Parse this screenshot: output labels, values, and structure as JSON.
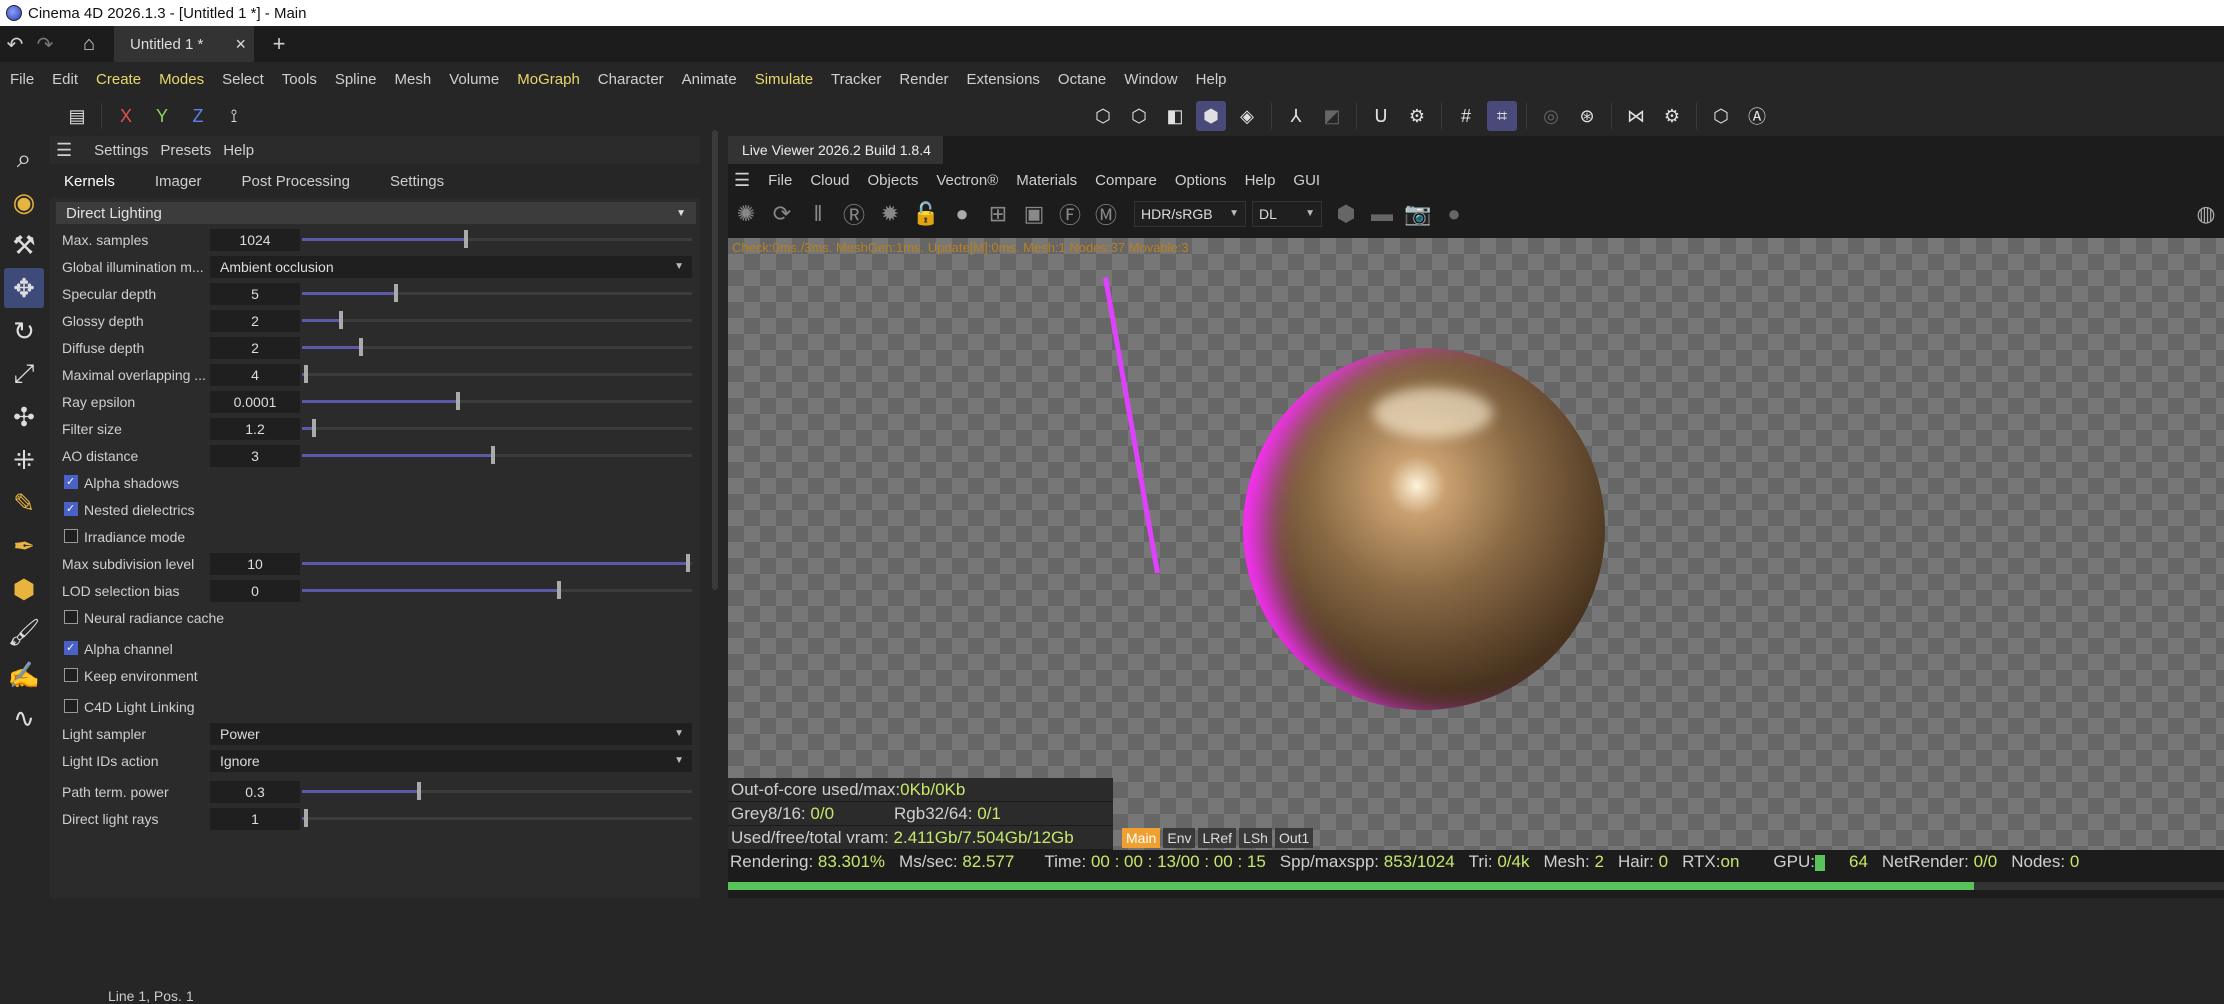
{
  "window_title": "Cinema 4D 2026.1.3 - [Untitled 1 *] - Main",
  "doc_tab": {
    "label": "Untitled 1 *",
    "close": "×",
    "add": "+"
  },
  "menu": [
    "File",
    "Edit",
    "Create",
    "Modes",
    "Select",
    "Tools",
    "Spline",
    "Mesh",
    "Volume",
    "MoGraph",
    "Character",
    "Animate",
    "Simulate",
    "Tracker",
    "Render",
    "Extensions",
    "Octane",
    "Window",
    "Help"
  ],
  "menu_highlight": [
    "Create",
    "Modes",
    "MoGraph",
    "Simulate"
  ],
  "axis": {
    "x": "X",
    "y": "Y",
    "z": "Z"
  },
  "panel": {
    "head": [
      "Settings",
      "Presets",
      "Help"
    ],
    "tabs": [
      "Kernels",
      "Imager",
      "Post Processing",
      "Settings"
    ],
    "kernel": "Direct Lighting",
    "rows": {
      "max_samples": {
        "label": "Max. samples",
        "value": "1024",
        "fill": 0.42
      },
      "gi_mode": {
        "label": "Global illumination m...",
        "value": "Ambient occlusion"
      },
      "specular_depth": {
        "label": "Specular depth",
        "value": "5",
        "fill": 0.24
      },
      "glossy_depth": {
        "label": "Glossy depth",
        "value": "2",
        "fill": 0.1
      },
      "diffuse_depth": {
        "label": "Diffuse depth",
        "value": "2",
        "fill": 0.15
      },
      "max_overlap": {
        "label": "Maximal overlapping ...",
        "value": "4",
        "fill": 0.01
      },
      "ray_epsilon": {
        "label": "Ray epsilon",
        "value": "0.0001",
        "fill": 0.4
      },
      "filter_size": {
        "label": "Filter size",
        "value": "1.2",
        "fill": 0.03
      },
      "ao_distance": {
        "label": "AO distance",
        "value": "3",
        "fill": 0.49
      },
      "alpha_shadows": {
        "label": "Alpha shadows",
        "checked": true
      },
      "nested_dielectrics": {
        "label": "Nested dielectrics",
        "checked": true
      },
      "irradiance_mode": {
        "label": "Irradiance mode",
        "checked": false
      },
      "max_subdiv": {
        "label": "Max subdivision level",
        "value": "10",
        "fill": 0.99
      },
      "lod_bias": {
        "label": "LOD selection bias",
        "value": "0",
        "fill": 0.66
      },
      "neural_cache": {
        "label": "Neural radiance cache",
        "checked": false
      },
      "alpha_channel": {
        "label": "Alpha channel",
        "checked": true
      },
      "keep_env": {
        "label": "Keep environment",
        "checked": false
      },
      "light_linking": {
        "label": "C4D Light Linking",
        "checked": false
      },
      "light_sampler": {
        "label": "Light sampler",
        "value": "Power"
      },
      "light_ids": {
        "label": "Light IDs action",
        "value": "Ignore"
      },
      "path_term": {
        "label": "Path term. power",
        "value": "0.3",
        "fill": 0.3
      },
      "direct_rays": {
        "label": "Direct light rays",
        "value": "1",
        "fill": 0.01
      }
    },
    "status": "Line 1, Pos. 1"
  },
  "viewer": {
    "tab": "Live Viewer 2026.2 Build 1.8.4",
    "menu": [
      "File",
      "Cloud",
      "Objects",
      "Vectron®",
      "Materials",
      "Compare",
      "Options",
      "Help",
      "GUI"
    ],
    "color_space": "HDR/sRGB",
    "kernel_short": "DL",
    "perf": "Check:0ms./3ms. MeshGen:1ms. Update[M]:0ms. Mesh:1 Nodes:37 Movable:3",
    "info": {
      "ooc_label": "Out-of-core used/max:",
      "ooc_value": "0Kb/0Kb",
      "grey_label": "Grey8/16:",
      "grey_value": "0/0",
      "rgb_label": "Rgb32/64:",
      "rgb_value": "0/1",
      "vram_label": "Used/free/total vram:",
      "vram_value": "2.411Gb/7.504Gb/12Gb"
    },
    "passes": [
      "Main",
      "Env",
      "LRef",
      "LSh",
      "Out1"
    ],
    "render": {
      "rendering_label": "Rendering:",
      "rendering": "83.301%",
      "mss_label": "Ms/sec:",
      "mss": "82.577",
      "time_label": "Time:",
      "time": "00 : 00 : 13/00 : 00 : 15",
      "spp_label": "Spp/maxspp:",
      "spp": "853/1024",
      "tri_label": "Tri:",
      "tri": "0/4k",
      "mesh_label": "Mesh:",
      "mesh": "2",
      "hair_label": "Hair:",
      "hair": "0",
      "rtx_label": "RTX:",
      "rtx": "on",
      "gpu_label": "GPU:",
      "gpu": "64",
      "netrender_label": "NetRender:",
      "netrender": "0/0",
      "nodes_label": "Nodes:",
      "nodes": "0"
    },
    "progress": 0.833
  }
}
